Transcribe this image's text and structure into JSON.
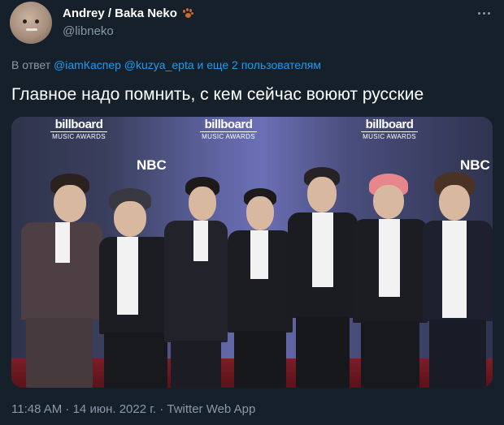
{
  "author": {
    "display_name": "Andrey / Baka Neko",
    "handle": "@libneko",
    "badge_icon": "paw-icon"
  },
  "reply": {
    "prefix": "В ответ",
    "mention_1": "@iamКаспер",
    "mention_2": "@kuzya_epta",
    "suffix": "и еще 2 пользователям"
  },
  "tweet": {
    "text": "Главное надо помнить, с кем сейчас воюют русские"
  },
  "media": {
    "logos": [
      {
        "title": "billboard",
        "subtitle": "MUSIC AWARDS"
      },
      {
        "title": "billboard",
        "subtitle": "MUSIC AWARDS"
      },
      {
        "title": "billboard",
        "subtitle": "MUSIC AWARDS"
      }
    ],
    "nbc_labels": [
      "NBC",
      "NBC"
    ]
  },
  "meta": {
    "timestamp": "11:48 AM · 14 июн. 2022 г. · Twitter Web App"
  },
  "colors": {
    "background": "#15202b",
    "secondary_text": "#8899a6",
    "link": "#1d9bf0"
  }
}
